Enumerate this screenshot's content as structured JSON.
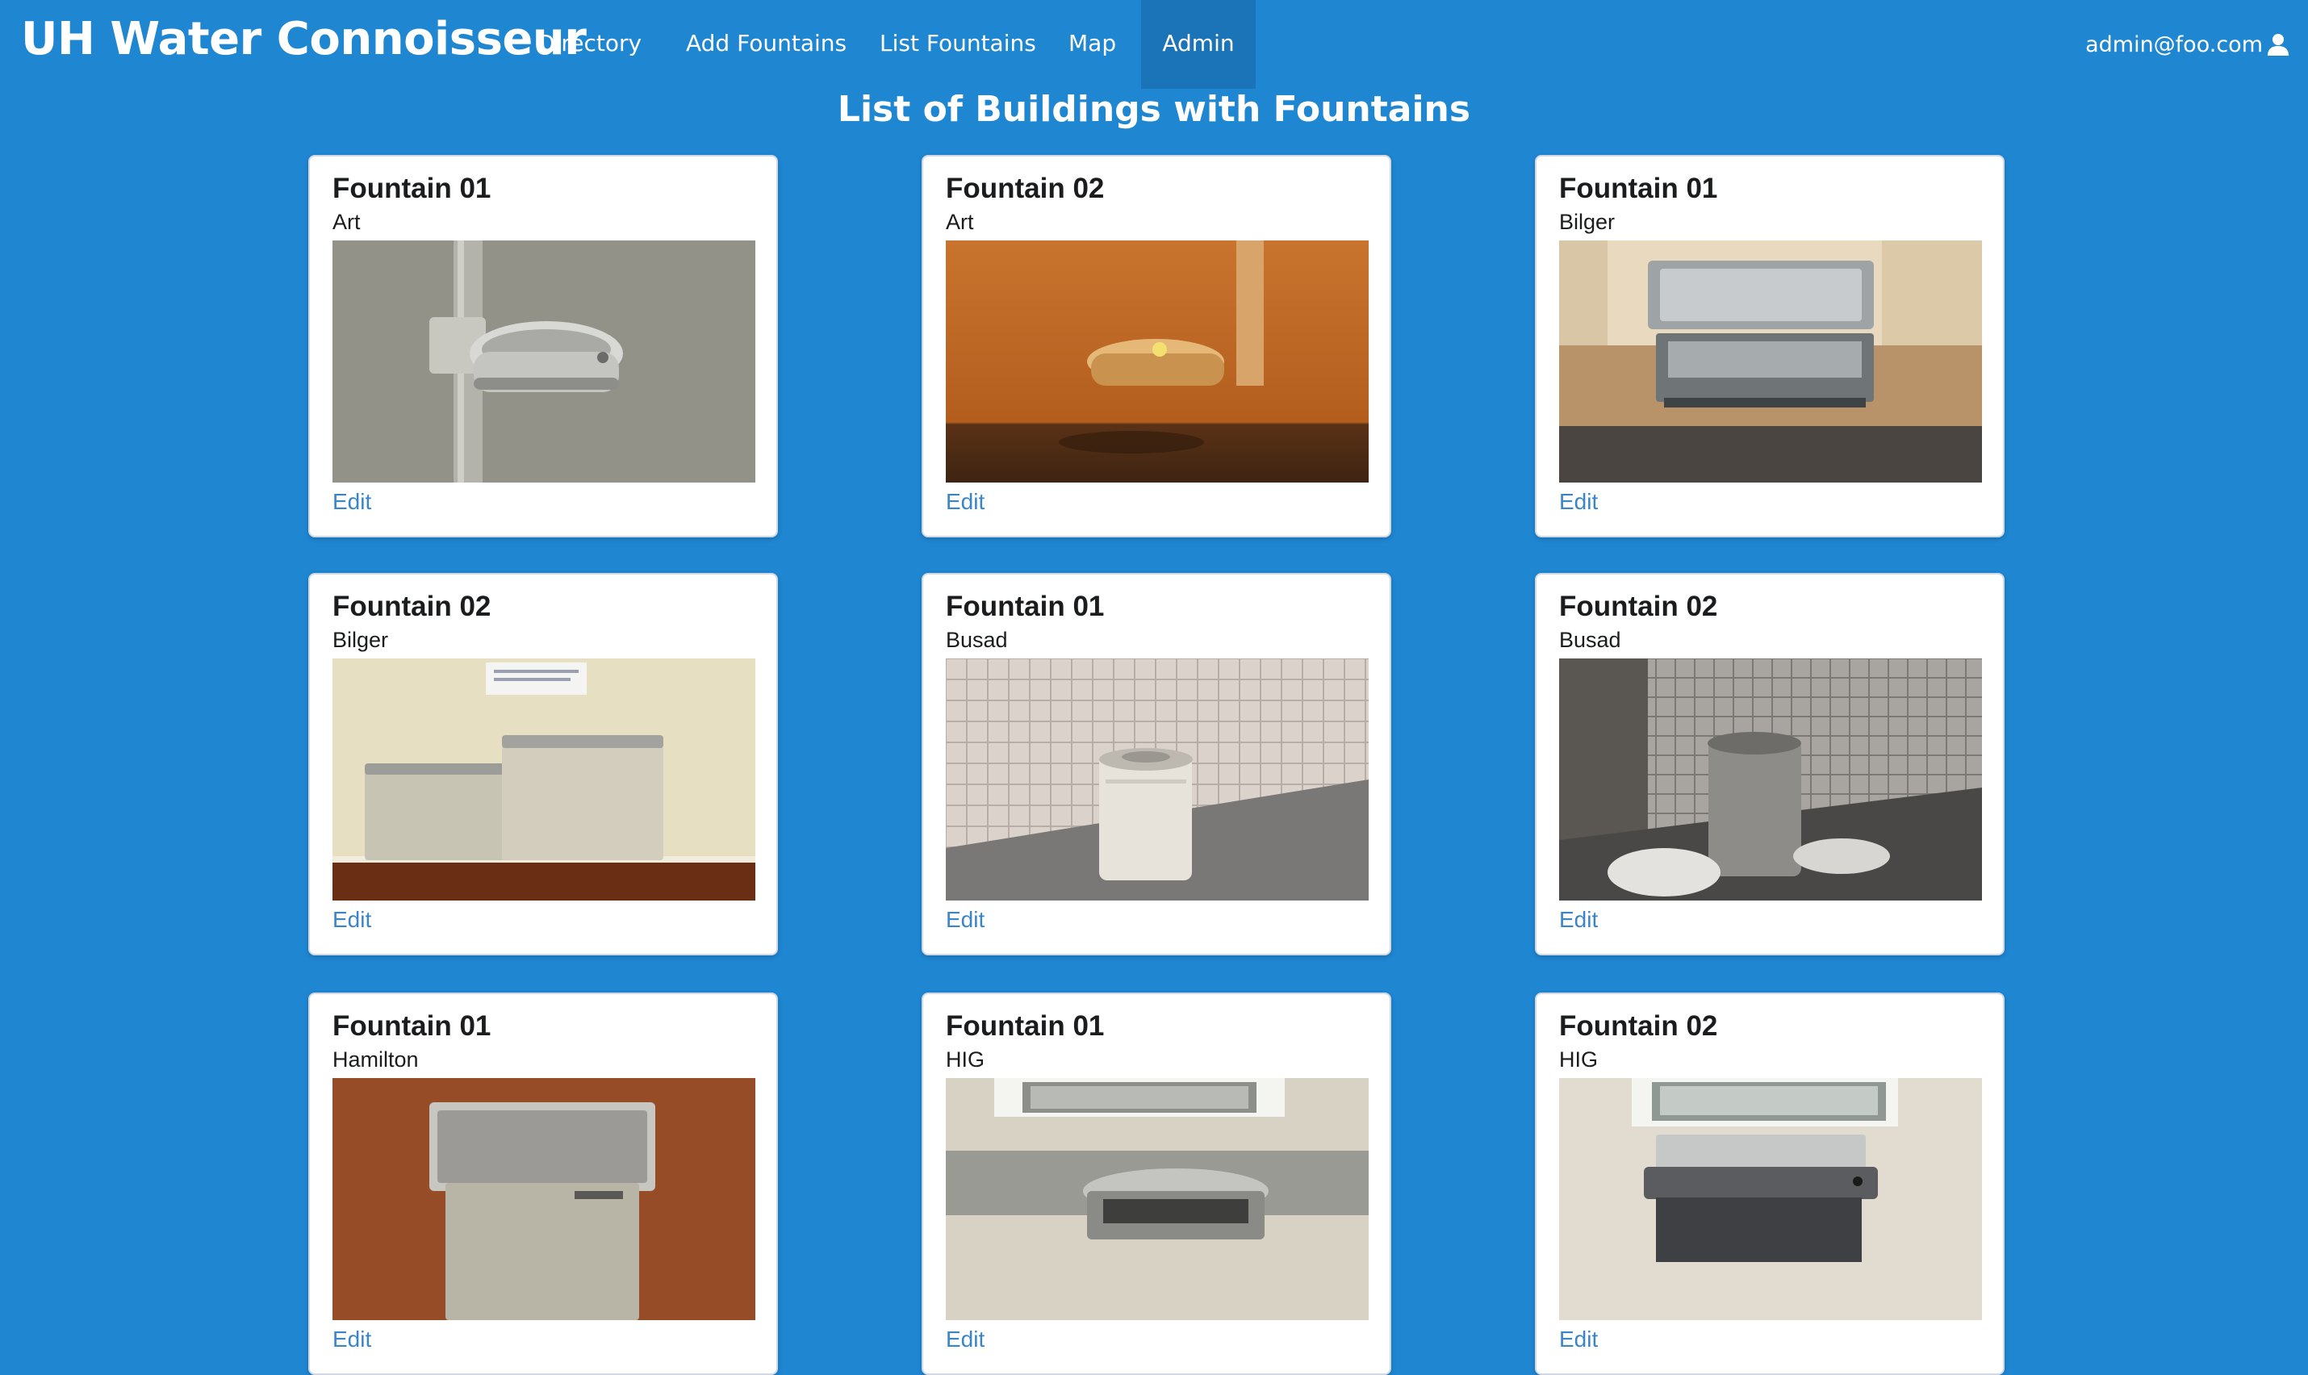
{
  "navbar": {
    "brand": "UH Water Connoisseur",
    "items": [
      {
        "label": "Directory"
      },
      {
        "label": "Add Fountains"
      },
      {
        "label": "List Fountains"
      },
      {
        "label": "Map"
      },
      {
        "label": "Admin",
        "active": true
      }
    ],
    "user": {
      "email": "admin@foo.com",
      "icon": "user-icon"
    }
  },
  "page": {
    "title": "List of Buildings with Fountains"
  },
  "colors": {
    "background": "#1f86d2",
    "navbar_active": "#1b74b8",
    "card": "#ffffff",
    "link": "#3a85c8"
  },
  "fountains": [
    {
      "name": "Fountain 01",
      "building": "Art",
      "edit_label": "Edit",
      "photo": "wall-mounted stainless fountain on gray stucco wall"
    },
    {
      "name": "Fountain 02",
      "building": "Art",
      "edit_label": "Edit",
      "photo": "wall fountain on orange-lit textured wall"
    },
    {
      "name": "Fountain 01",
      "building": "Bilger",
      "edit_label": "Edit",
      "photo": "bottle-filling station in beige corner"
    },
    {
      "name": "Fountain 02",
      "building": "Bilger",
      "edit_label": "Edit",
      "photo": "dual beige fountains with sign"
    },
    {
      "name": "Fountain 01",
      "building": "Busad",
      "edit_label": "Edit",
      "photo": "white pedestal fountain by tiled wall"
    },
    {
      "name": "Fountain 02",
      "building": "Busad",
      "edit_label": "Edit",
      "photo": "gray pedestal fountain with sandbags"
    },
    {
      "name": "Fountain 01",
      "building": "Hamilton",
      "edit_label": "Edit",
      "photo": "stainless fountain on wood panel wall"
    },
    {
      "name": "Fountain 01",
      "building": "HIG",
      "edit_label": "Edit",
      "photo": "wall fountain under window"
    },
    {
      "name": "Fountain 02",
      "building": "HIG",
      "edit_label": "Edit",
      "photo": "bottle filler under window"
    }
  ]
}
